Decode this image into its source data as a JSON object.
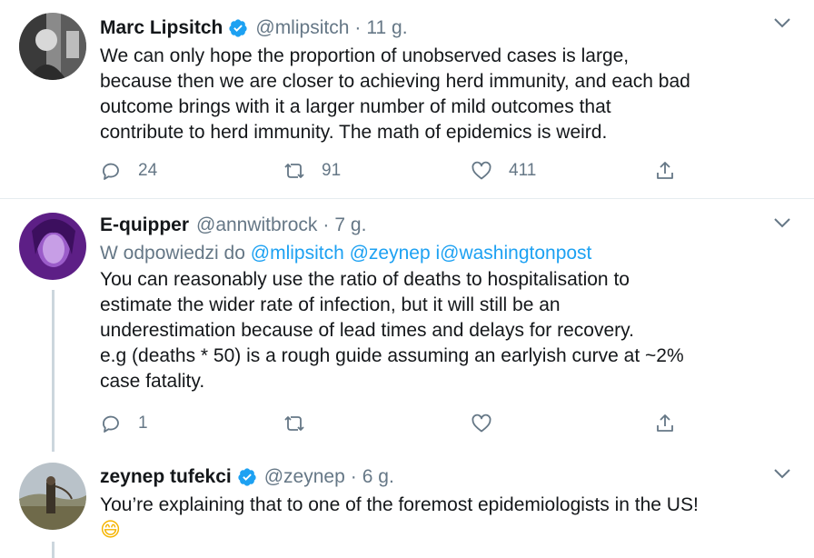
{
  "tweets": [
    {
      "name": "Marc Lipsitch",
      "verified": true,
      "handle": "@mlipsitch",
      "dot": "·",
      "time": "11 g.",
      "lines": [
        "We can only hope the proportion of unobserved cases is large,",
        "because then we are closer to achieving herd immunity, and each bad",
        "outcome brings with it a larger number of mild outcomes that",
        "contribute to herd immunity. The math of epidemics is weird."
      ],
      "replies": "24",
      "retweets": "91",
      "likes": "411"
    },
    {
      "name": "E-quipper",
      "verified": false,
      "handle": "@annwitbrock",
      "dot": "·",
      "time": "7 g.",
      "reply_prefix": "W odpowiedzi do ",
      "reply_links": "@mlipsitch @zeynep i@washingtonpost",
      "lines": [
        "You can reasonably use the ratio of deaths to hospitalisation to",
        "estimate the wider rate of infection, but it will still be an",
        "underestimation because of lead times and delays for recovery.",
        "e.g (deaths * 50) is a rough guide assuming an earlyish curve at ~2%",
        "case fatality."
      ],
      "replies": "1",
      "retweets": "",
      "likes": ""
    },
    {
      "name": "zeynep tufekci",
      "verified": true,
      "handle": "@zeynep",
      "dot": "·",
      "time": "6 g.",
      "lines": [
        "You’re explaining that to one of the foremost epidemiologists in the US!"
      ],
      "emoji": "😄"
    }
  ],
  "colors": {
    "text": "#14171a",
    "secondary": "#657786",
    "link": "#1da1f2",
    "verified": "#1da1f2",
    "thread_line": "#ccd6dd",
    "divider": "#e6ecf0"
  },
  "icons": [
    "verified-badge-icon",
    "chevron-down-icon",
    "reply-icon",
    "retweet-icon",
    "like-icon",
    "share-icon"
  ]
}
